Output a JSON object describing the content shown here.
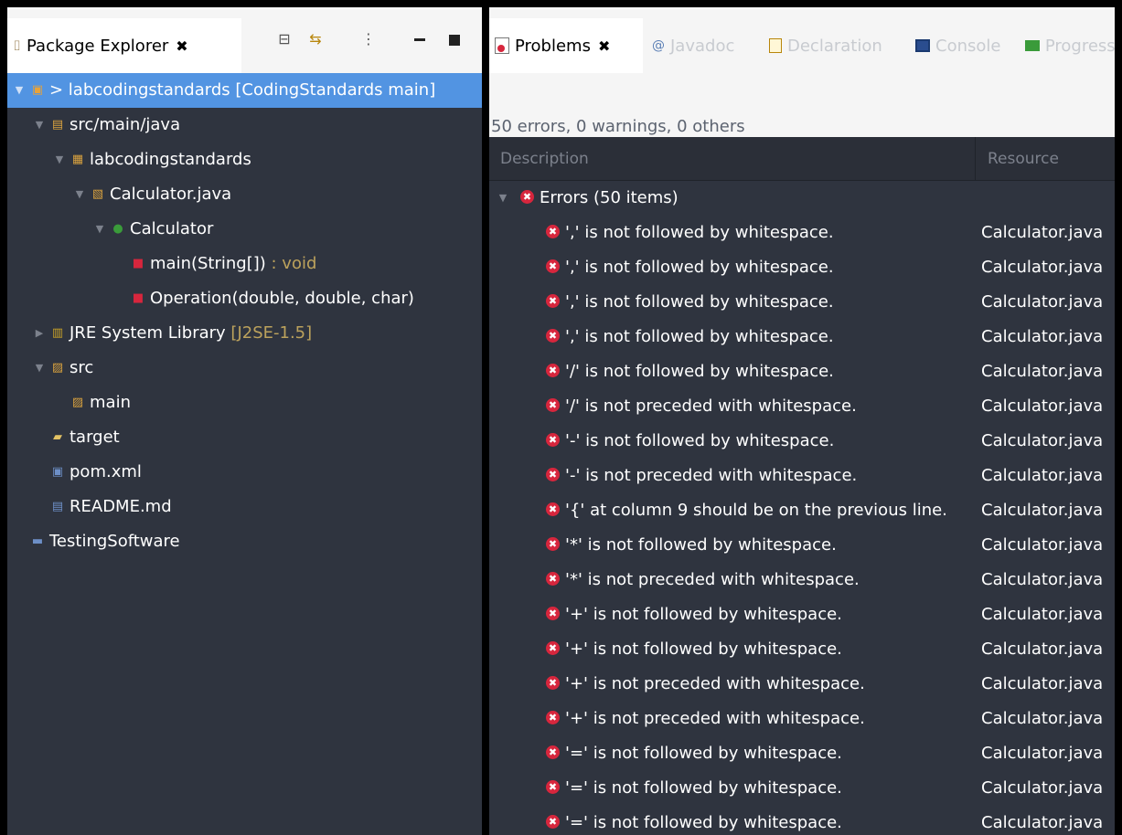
{
  "left_panel": {
    "tab_label": "Package Explorer",
    "tree": [
      {
        "label": "> labcodingstandards [CodingStandards main]",
        "suffix": "",
        "level": 0,
        "twisty": "expanded",
        "icon": "project-icon",
        "selected": true
      },
      {
        "label": "src/main/java",
        "suffix": "",
        "level": 1,
        "twisty": "expanded",
        "icon": "source-folder-icon",
        "selected": false
      },
      {
        "label": "labcodingstandards",
        "suffix": "",
        "level": 2,
        "twisty": "expanded",
        "icon": "package-icon",
        "selected": false
      },
      {
        "label": "Calculator.java",
        "suffix": "",
        "level": 3,
        "twisty": "expanded",
        "icon": "java-file-icon",
        "selected": false
      },
      {
        "label": "Calculator",
        "suffix": "",
        "level": 4,
        "twisty": "expanded",
        "icon": "class-icon",
        "selected": false
      },
      {
        "label": "main(String[])",
        "suffix": " : void",
        "level": 5,
        "twisty": "none",
        "icon": "method-icon",
        "selected": false
      },
      {
        "label": "Operation(double, double, char)",
        "suffix": "",
        "level": 5,
        "twisty": "none",
        "icon": "method-icon",
        "selected": false
      },
      {
        "label": "JRE System Library",
        "suffix": " [J2SE-1.5]",
        "level": 1,
        "twisty": "collapsed",
        "icon": "library-icon",
        "selected": false
      },
      {
        "label": "src",
        "suffix": "",
        "level": 1,
        "twisty": "expanded",
        "icon": "folder-icon",
        "selected": false
      },
      {
        "label": "main",
        "suffix": "",
        "level": 2,
        "twisty": "none",
        "icon": "folder-icon",
        "selected": false
      },
      {
        "label": "target",
        "suffix": "",
        "level": 1,
        "twisty": "none",
        "icon": "open-folder-icon",
        "selected": false
      },
      {
        "label": "pom.xml",
        "suffix": "",
        "level": 1,
        "twisty": "none",
        "icon": "xml-file-icon",
        "selected": false
      },
      {
        "label": "README.md",
        "suffix": "",
        "level": 1,
        "twisty": "none",
        "icon": "markdown-file-icon",
        "selected": false
      },
      {
        "label": "TestingSoftware",
        "suffix": "",
        "level": 0,
        "twisty": "none",
        "icon": "closed-project-icon",
        "selected": false
      }
    ]
  },
  "right_panel": {
    "tabs": [
      {
        "label": "Problems",
        "active": true,
        "icon": "problems-icon"
      },
      {
        "label": "Javadoc",
        "active": false,
        "icon": "javadoc-icon"
      },
      {
        "label": "Declaration",
        "active": false,
        "icon": "declaration-icon"
      },
      {
        "label": "Console",
        "active": false,
        "icon": "console-icon"
      },
      {
        "label": "Progress",
        "active": false,
        "icon": "progress-icon"
      }
    ],
    "status": "50 errors, 0 warnings, 0 others",
    "columns": {
      "description": "Description",
      "resource": "Resource"
    },
    "group_label": "Errors (50 items)",
    "errors": [
      {
        "description": "',' is not followed by whitespace.",
        "resource": "Calculator.java"
      },
      {
        "description": "',' is not followed by whitespace.",
        "resource": "Calculator.java"
      },
      {
        "description": "',' is not followed by whitespace.",
        "resource": "Calculator.java"
      },
      {
        "description": "',' is not followed by whitespace.",
        "resource": "Calculator.java"
      },
      {
        "description": "'/' is not followed by whitespace.",
        "resource": "Calculator.java"
      },
      {
        "description": "'/' is not preceded with whitespace.",
        "resource": "Calculator.java"
      },
      {
        "description": "'-' is not followed by whitespace.",
        "resource": "Calculator.java"
      },
      {
        "description": "'-' is not preceded with whitespace.",
        "resource": "Calculator.java"
      },
      {
        "description": "'{' at column 9 should be on the previous line.",
        "resource": "Calculator.java"
      },
      {
        "description": "'*' is not followed by whitespace.",
        "resource": "Calculator.java"
      },
      {
        "description": "'*' is not preceded with whitespace.",
        "resource": "Calculator.java"
      },
      {
        "description": "'+' is not followed by whitespace.",
        "resource": "Calculator.java"
      },
      {
        "description": "'+' is not followed by whitespace.",
        "resource": "Calculator.java"
      },
      {
        "description": "'+' is not preceded with whitespace.",
        "resource": "Calculator.java"
      },
      {
        "description": "'+' is not preceded with whitespace.",
        "resource": "Calculator.java"
      },
      {
        "description": "'=' is not followed by whitespace.",
        "resource": "Calculator.java"
      },
      {
        "description": "'=' is not followed by whitespace.",
        "resource": "Calculator.java"
      },
      {
        "description": "'=' is not followed by whitespace.",
        "resource": "Calculator.java"
      }
    ]
  }
}
